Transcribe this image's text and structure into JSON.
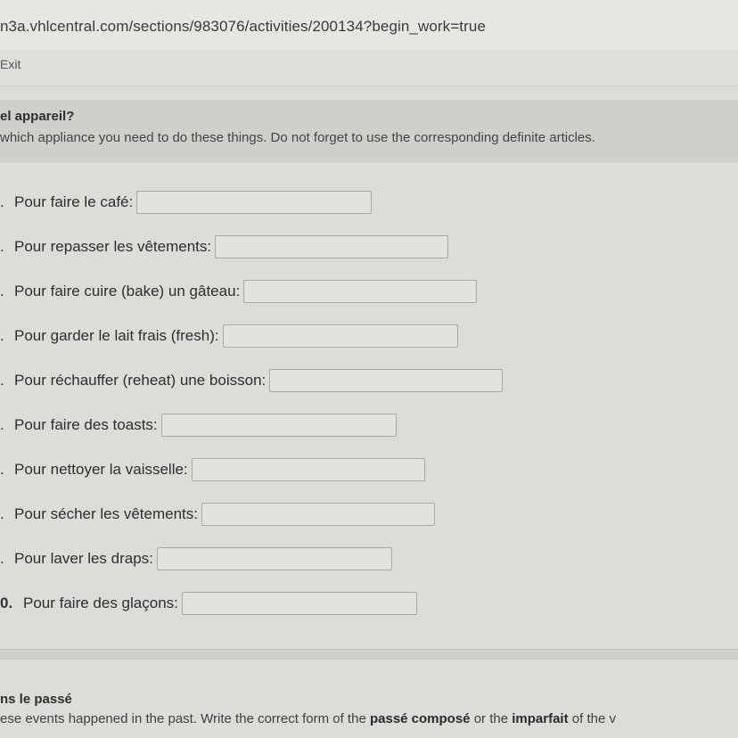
{
  "browser": {
    "url": "n3a.vhlcentral.com/sections/983076/activities/200134?begin_work=true"
  },
  "toolbar": {
    "exit_label": "Exit"
  },
  "section1": {
    "title": "el appareil?",
    "instructions": "which appliance you need to do these things. Do not forget to use the corresponding definite articles."
  },
  "questions": [
    {
      "number": ".",
      "label": "Pour faire le café:",
      "value": ""
    },
    {
      "number": ".",
      "label": "Pour repasser les vêtements:",
      "value": ""
    },
    {
      "number": ".",
      "label": "Pour faire cuire (bake) un gâteau:",
      "value": ""
    },
    {
      "number": ".",
      "label": "Pour garder le lait frais (fresh):",
      "value": ""
    },
    {
      "number": ".",
      "label": "Pour réchauffer (reheat) une boisson:",
      "value": ""
    },
    {
      "number": ".",
      "label": "Pour faire des toasts:",
      "value": ""
    },
    {
      "number": ".",
      "label": "Pour nettoyer la vaisselle:",
      "value": ""
    },
    {
      "number": ".",
      "label": "Pour sécher les vêtements:",
      "value": ""
    },
    {
      "number": ".",
      "label": "Pour laver les draps:",
      "value": ""
    },
    {
      "number": "0.",
      "label": "Pour faire des glaçons:",
      "value": ""
    }
  ],
  "section2": {
    "title": "ns le passé",
    "instr_pre": "ese events happened in the past. Write the correct form of the ",
    "instr_bold1": "passé composé",
    "instr_mid": " or the ",
    "instr_bold2": "imparfait",
    "instr_post": " of the v"
  }
}
